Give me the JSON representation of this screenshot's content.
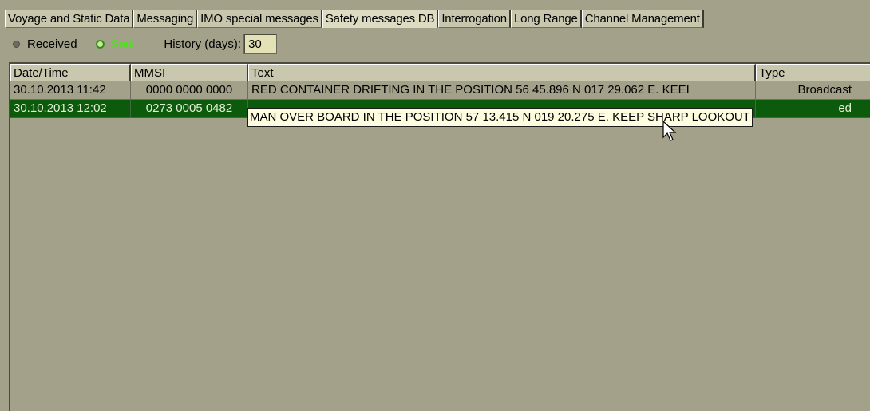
{
  "tabs": [
    {
      "label": "Voyage and Static Data",
      "active": false
    },
    {
      "label": "Messaging",
      "active": false
    },
    {
      "label": "IMO special messages",
      "active": false
    },
    {
      "label": "Safety messages DB",
      "active": true
    },
    {
      "label": "Interrogation",
      "active": false
    },
    {
      "label": "Long Range",
      "active": false
    },
    {
      "label": "Channel Management",
      "active": false
    }
  ],
  "filter": {
    "received_label": "Received",
    "sent_label": "Sent",
    "selected": "Sent",
    "history_label": "History (days):",
    "history_value": "30"
  },
  "table": {
    "headers": [
      "Date/Time",
      "MMSI",
      "Text",
      "Type"
    ],
    "rows": [
      {
        "datetime": "30.10.2013 11:42",
        "mmsi": "0000 0000 0000",
        "text": "RED CONTAINER DRIFTING IN THE POSITION 56 45.896 N 017 29.062 E. KEEI",
        "type": "Broadcast",
        "selected": false
      },
      {
        "datetime": "30.10.2013 12:02",
        "mmsi": "0273 0005 0482",
        "text": "",
        "type": "ed",
        "selected": true
      }
    ]
  },
  "tooltip": {
    "text": "MAN OVER BOARD IN THE POSITION 57 13.415 N 019 20.275 E. KEEP SHARP LOOKOUT"
  },
  "colors": {
    "background": "#a3a189",
    "selected_row": "#0c5a0c",
    "sent_radio": "#50e020",
    "tooltip_bg": "#fffde0"
  }
}
